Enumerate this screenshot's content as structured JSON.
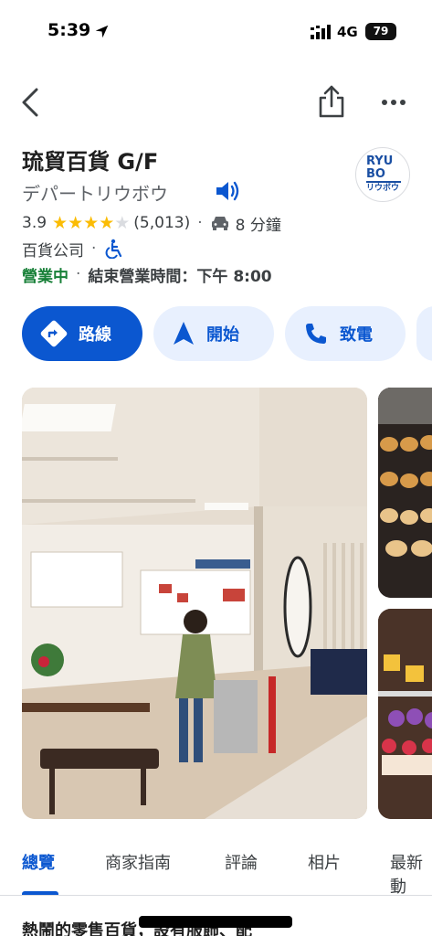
{
  "status_bar": {
    "time": "5:39",
    "network": "4G",
    "battery": "79",
    "icons": [
      "location-arrow-icon",
      "signal-icon"
    ]
  },
  "nav": {
    "icons": [
      "back-arrow-icon",
      "share-icon",
      "more-dots-icon"
    ]
  },
  "place": {
    "name": "琉貿百貨 G/F",
    "alt_name": "デパートリウボウ",
    "logo": {
      "line1": "RYU",
      "line2": "BO",
      "line3": "リウボウ"
    },
    "rating": "3.9",
    "stars": 3.9,
    "review_count": "(5,013)",
    "drive_time": "8 分鐘",
    "category": "百貨公司",
    "status": "營業中",
    "hours": "結束營業時間：下午 8:00",
    "separator": "·"
  },
  "actions": [
    {
      "label": "路線",
      "icon": "directions-icon"
    },
    {
      "label": "開始",
      "icon": "navigation-arrow-icon"
    },
    {
      "label": "致電",
      "icon": "phone-icon"
    }
  ],
  "tabs": [
    {
      "label": "總覽",
      "active": true
    },
    {
      "label": "商家指南",
      "active": false
    },
    {
      "label": "評論",
      "active": false
    },
    {
      "label": "相片",
      "active": false
    },
    {
      "label": "最新動",
      "active": false
    }
  ],
  "description": "熱鬧的零售百貨，設有服飾、配",
  "colors": {
    "accent": "#0b57d0",
    "open_green": "#188038",
    "star": "#fbbc04",
    "chip_bg": "#e8f0fe"
  }
}
